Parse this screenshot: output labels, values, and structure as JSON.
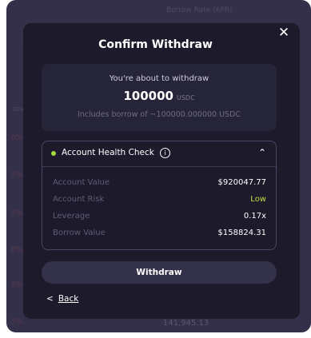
{
  "background": {
    "header_text": "Borrow Rate (APR)",
    "side_label": "rov",
    "bottom_value": "141,945.13",
    "peek_marks": [
      "$",
      "0%",
      "5%",
      "5%",
      "0%",
      "5%",
      "5%",
      "5%"
    ]
  },
  "modal": {
    "title": "Confirm Withdraw",
    "close_icon": "close-icon",
    "summary": {
      "intro": "You're about to withdraw",
      "amount": "100000",
      "unit": "USDC",
      "borrow_note": "Includes borrow of ~100000.000000 USDC"
    },
    "health": {
      "title": "Account Health Check",
      "status_color": "#a6d93b",
      "icons": {
        "info": "info-icon",
        "collapse": "chevron-up-icon"
      },
      "rows": [
        {
          "label": "Account Value",
          "value": "$920047.77"
        },
        {
          "label": "Account Risk",
          "value": "Low"
        },
        {
          "label": "Leverage",
          "value": "0.17x"
        },
        {
          "label": "Borrow Value",
          "value": "$158824.31"
        }
      ]
    },
    "withdraw_label": "Withdraw",
    "back_label": "Back"
  }
}
